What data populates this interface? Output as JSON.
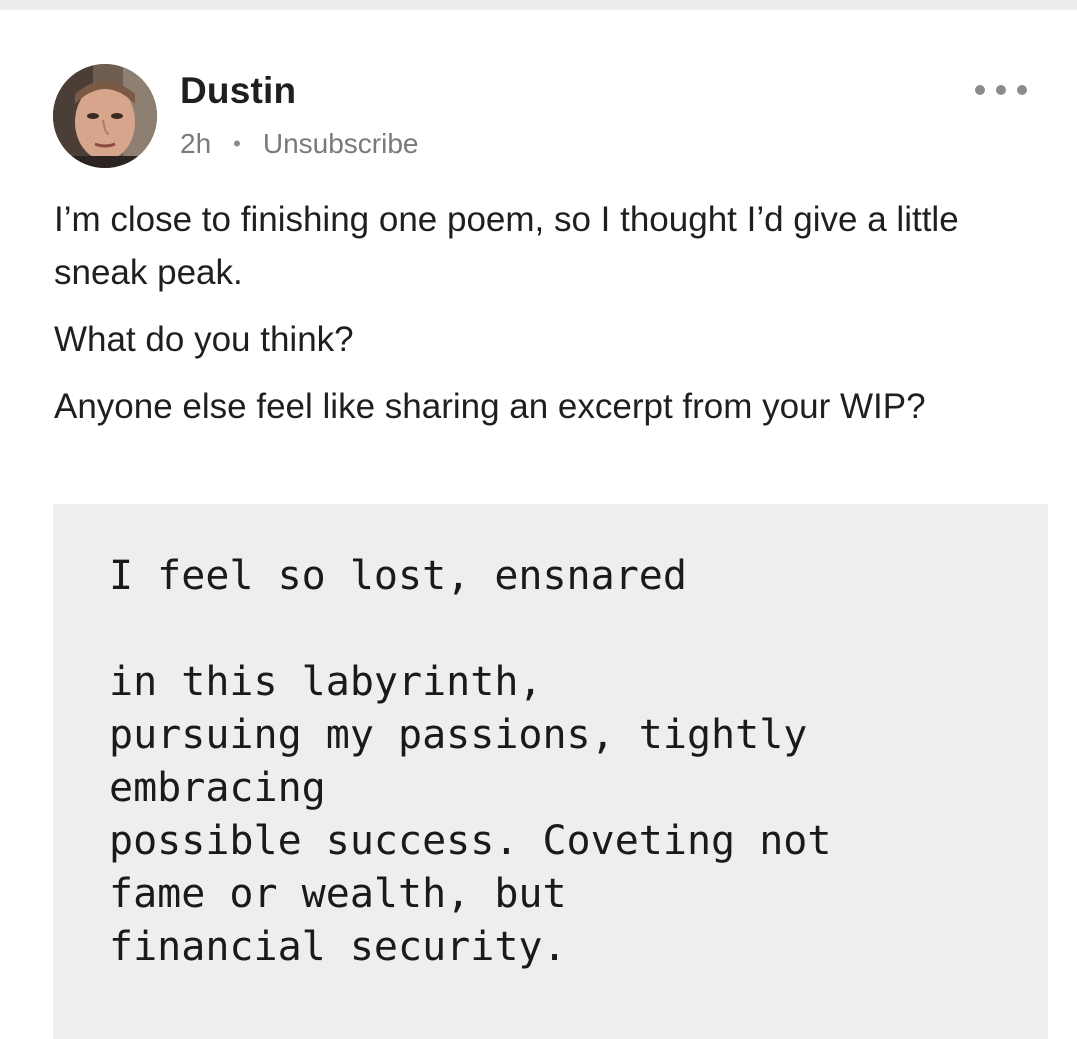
{
  "post": {
    "author": {
      "name": "Dustin",
      "avatar": "profile-photo"
    },
    "meta": {
      "time": "2h",
      "separator": "•",
      "unsubscribe_label": "Unsubscribe"
    },
    "more_icon": "more-horizontal-icon",
    "paragraphs": [
      "I’m close to finishing one poem, so I thought I’d give a little sneak peak.",
      "What do you think?",
      "Anyone else feel like sharing an excerpt from your WIP?"
    ],
    "code_block": {
      "lines": [
        "I feel so lost, ensnared",
        "",
        "in this labyrinth,",
        "pursuing my passions, tightly",
        "embracing",
        "possible success. Coveting not",
        "fame or wealth, but",
        "financial security."
      ]
    }
  },
  "colors": {
    "background": "#ffffff",
    "top_strip": "#ececec",
    "code_background": "#eeeeee",
    "meta_text": "#7a7a7a",
    "body_text": "#1f1f1f"
  }
}
